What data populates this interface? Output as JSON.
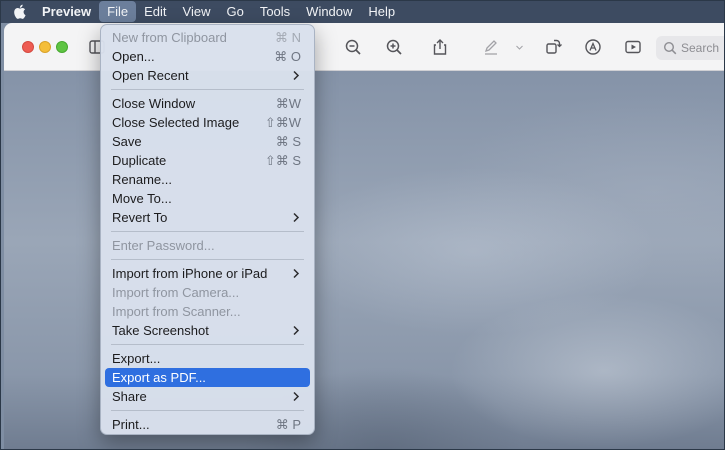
{
  "menubar": {
    "apple_icon": "apple-logo-icon",
    "items": [
      "Preview",
      "File",
      "Edit",
      "View",
      "Go",
      "Tools",
      "Window",
      "Help"
    ],
    "active": "File"
  },
  "toolbar": {
    "icons": [
      "sidebar-icon",
      "zoom-out-icon",
      "zoom-in-icon",
      "share-icon",
      "markup-pen-icon",
      "chevron-down-icon",
      "rotate-icon",
      "annotate-icon",
      "slideshow-icon"
    ],
    "search_placeholder": "Search"
  },
  "file_menu": {
    "groups": [
      [
        {
          "label": "New from Clipboard",
          "shortcut": "⌘ N",
          "disabled": true
        },
        {
          "label": "Open...",
          "shortcut": "⌘ O"
        },
        {
          "label": "Open Recent",
          "submenu": true
        }
      ],
      [
        {
          "label": "Close Window",
          "shortcut": "⌘W"
        },
        {
          "label": "Close Selected Image",
          "shortcut": "⇧⌘W"
        },
        {
          "label": "Save",
          "shortcut": "⌘ S"
        },
        {
          "label": "Duplicate",
          "shortcut": "⇧⌘ S"
        },
        {
          "label": "Rename..."
        },
        {
          "label": "Move To..."
        },
        {
          "label": "Revert To",
          "submenu": true
        }
      ],
      [
        {
          "label": "Enter Password...",
          "disabled": true
        }
      ],
      [
        {
          "label": "Import from iPhone or iPad",
          "submenu": true
        },
        {
          "label": "Import from Camera...",
          "disabled": true
        },
        {
          "label": "Import from Scanner...",
          "disabled": true
        },
        {
          "label": "Take Screenshot",
          "submenu": true
        }
      ],
      [
        {
          "label": "Export..."
        },
        {
          "label": "Export as PDF...",
          "selected": true
        },
        {
          "label": "Share",
          "submenu": true
        }
      ],
      [
        {
          "label": "Print...",
          "shortcut": "⌘ P"
        }
      ]
    ]
  },
  "colors": {
    "menubar": "#3d4b61",
    "menu_bg": "#d9e0ec",
    "selection": "#2f6fe0"
  }
}
